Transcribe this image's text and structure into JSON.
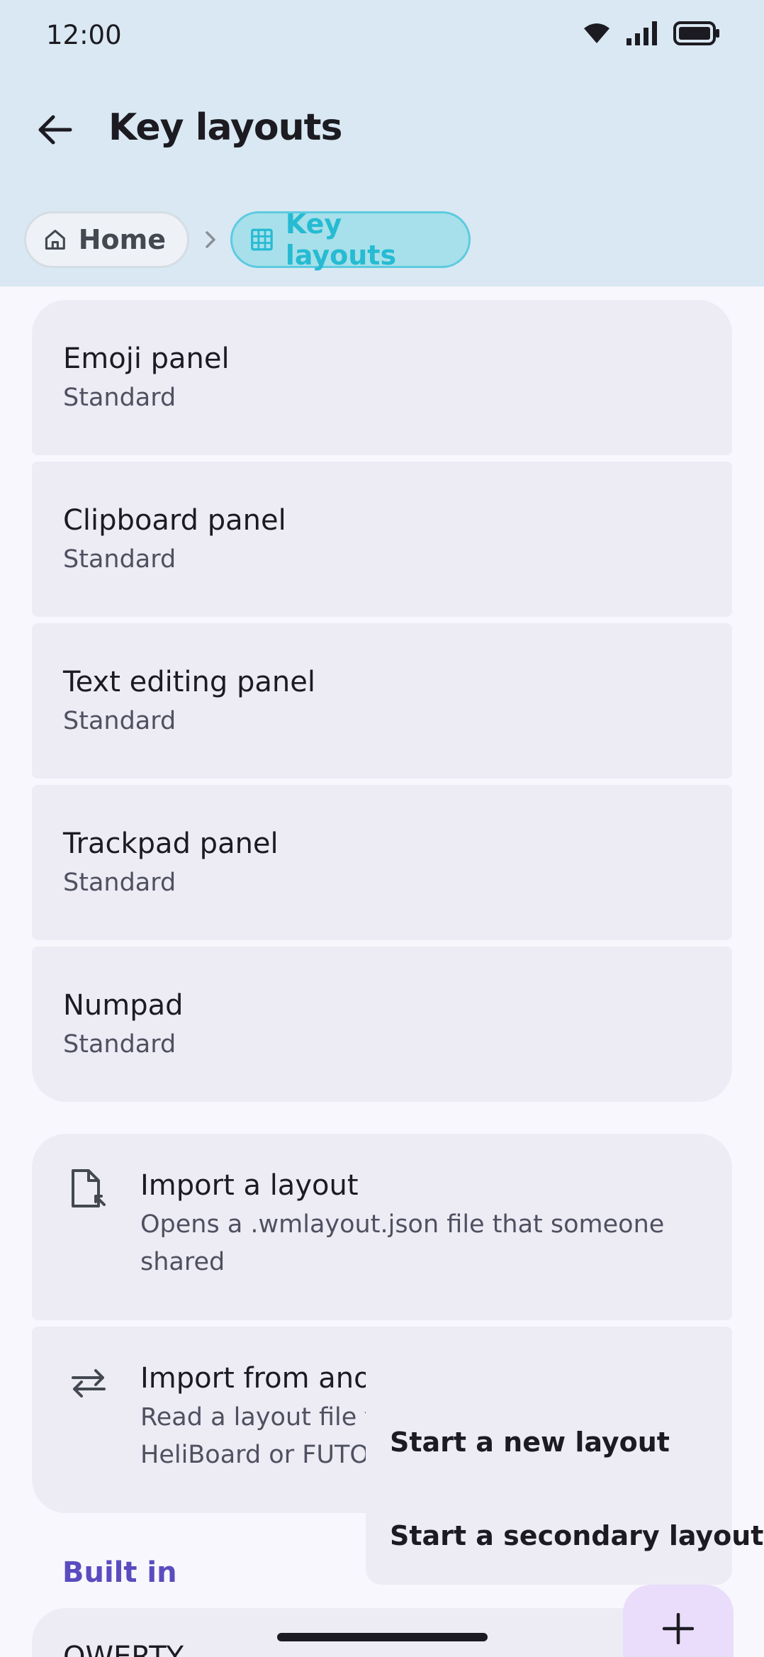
{
  "status_bar": {
    "time": "12:00",
    "icons": [
      "wifi-icon",
      "signal-icon",
      "battery-icon"
    ]
  },
  "app_bar": {
    "title": "Key layouts",
    "back_icon": "arrow-back-icon"
  },
  "breadcrumbs": [
    {
      "label": "Home",
      "icon": "home-icon"
    },
    {
      "label": "Key layouts",
      "icon": "grid-icon",
      "active": true
    }
  ],
  "panels": [
    {
      "title": "Emoji panel",
      "subtitle": "Standard"
    },
    {
      "title": "Clipboard panel",
      "subtitle": "Standard"
    },
    {
      "title": "Text editing panel",
      "subtitle": "Standard"
    },
    {
      "title": "Trackpad panel",
      "subtitle": "Standard"
    },
    {
      "title": "Numpad",
      "subtitle": "Standard"
    }
  ],
  "actions": [
    {
      "title": "Import a layout",
      "description_lines": [
        "Opens a .wmlayout.json file that someone",
        "shared"
      ],
      "icon": "file-import-icon"
    },
    {
      "title": "Import from ano",
      "description_lines": [
        "Read a layout file f",
        "HeliBoard or FUTO"
      ],
      "icon": "swap-arrows-icon"
    }
  ],
  "section_header": "Built in",
  "built_in_first": "QWERTY",
  "popup_menu": [
    "Start a new layout",
    "Start a secondary layout"
  ],
  "fab": {
    "icon": "add-icon"
  },
  "colors": {
    "app_bar": "#d9e8f2",
    "accent_cyan": "#26bbd3",
    "section": "#5a4cbf",
    "card": "#edecf5",
    "fab": "#e9ddfb"
  }
}
